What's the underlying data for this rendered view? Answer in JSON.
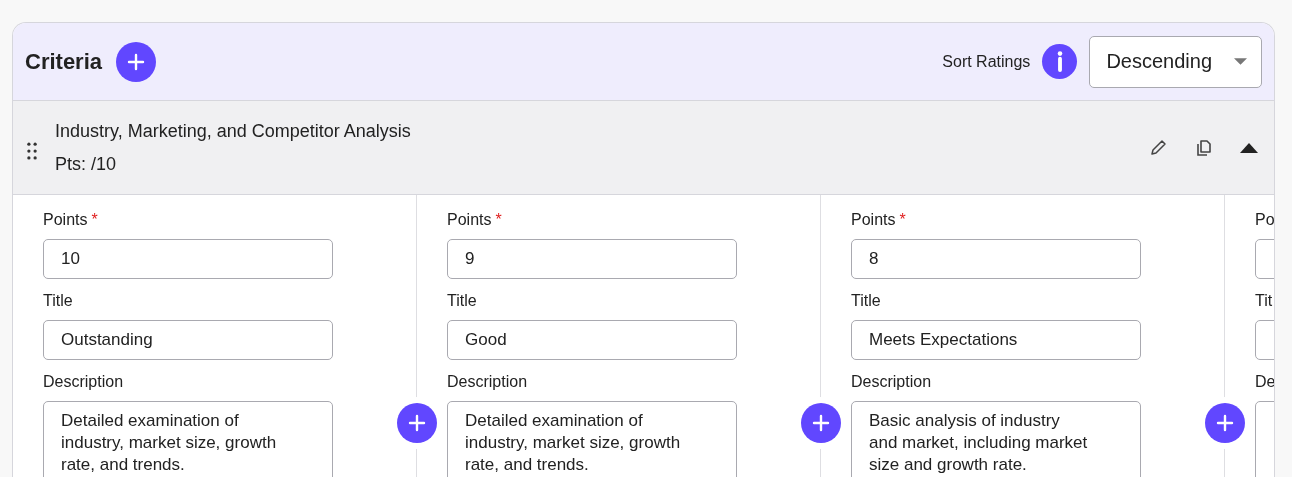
{
  "header": {
    "title": "Criteria",
    "sort_label": "Sort Ratings",
    "sort_value": "Descending"
  },
  "criterion": {
    "name": "Industry, Marketing, and Competitor Analysis",
    "points": "Pts: /10",
    "expanded": true
  },
  "levels": [
    {
      "points_label": "Points",
      "required_mark": "*",
      "points": "10",
      "title_label": "Title",
      "title": "Outstanding",
      "description_label": "Description",
      "description": "Detailed examination of industry, market size, growth rate, and trends."
    },
    {
      "points_label": "Points",
      "required_mark": "*",
      "points": "9",
      "title_label": "Title",
      "title": "Good",
      "description_label": "Description",
      "description": "Detailed examination of industry, market size, growth rate, and trends."
    },
    {
      "points_label": "Points",
      "required_mark": "*",
      "points": "8",
      "title_label": "Title",
      "title": "Meets Expectations",
      "description_label": "Description",
      "description": "Basic analysis of industry and market, including market size and growth rate."
    },
    {
      "points_label": "Po",
      "title_label": "Tit",
      "description_label": "De"
    }
  ]
}
